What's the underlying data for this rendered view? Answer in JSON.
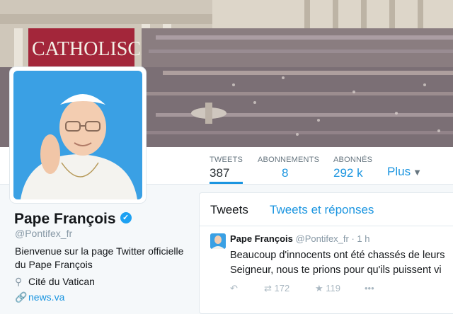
{
  "banner": {
    "sign_text": "CATHOLISCHE"
  },
  "nav": {
    "tweets_label": "TWEETS",
    "tweets_value": "387",
    "following_label": "ABONNEMENTS",
    "following_value": "8",
    "followers_label": "ABONNÉS",
    "followers_value": "292 k",
    "more_label": "Plus"
  },
  "profile": {
    "name": "Pape François",
    "handle": "@Pontifex_fr",
    "bio_line1": "Bienvenue sur la page Twitter officielle",
    "bio_line2": "du Pape François",
    "location": "Cité du Vatican",
    "website": "news.va"
  },
  "timeline": {
    "tab_tweets": "Tweets",
    "tab_replies": "Tweets et réponses",
    "tweet": {
      "name": "Pape François",
      "handle": "@Pontifex_fr",
      "time": "· 1 h",
      "text_line1": "Beaucoup d'innocents ont été chassés de leurs",
      "text_line2": "Seigneur, nous te prions pour qu'ils puissent vi",
      "retweets": "172",
      "likes": "119"
    }
  },
  "colors": {
    "accent": "#1b95e0",
    "verified": "#1da1f2"
  }
}
